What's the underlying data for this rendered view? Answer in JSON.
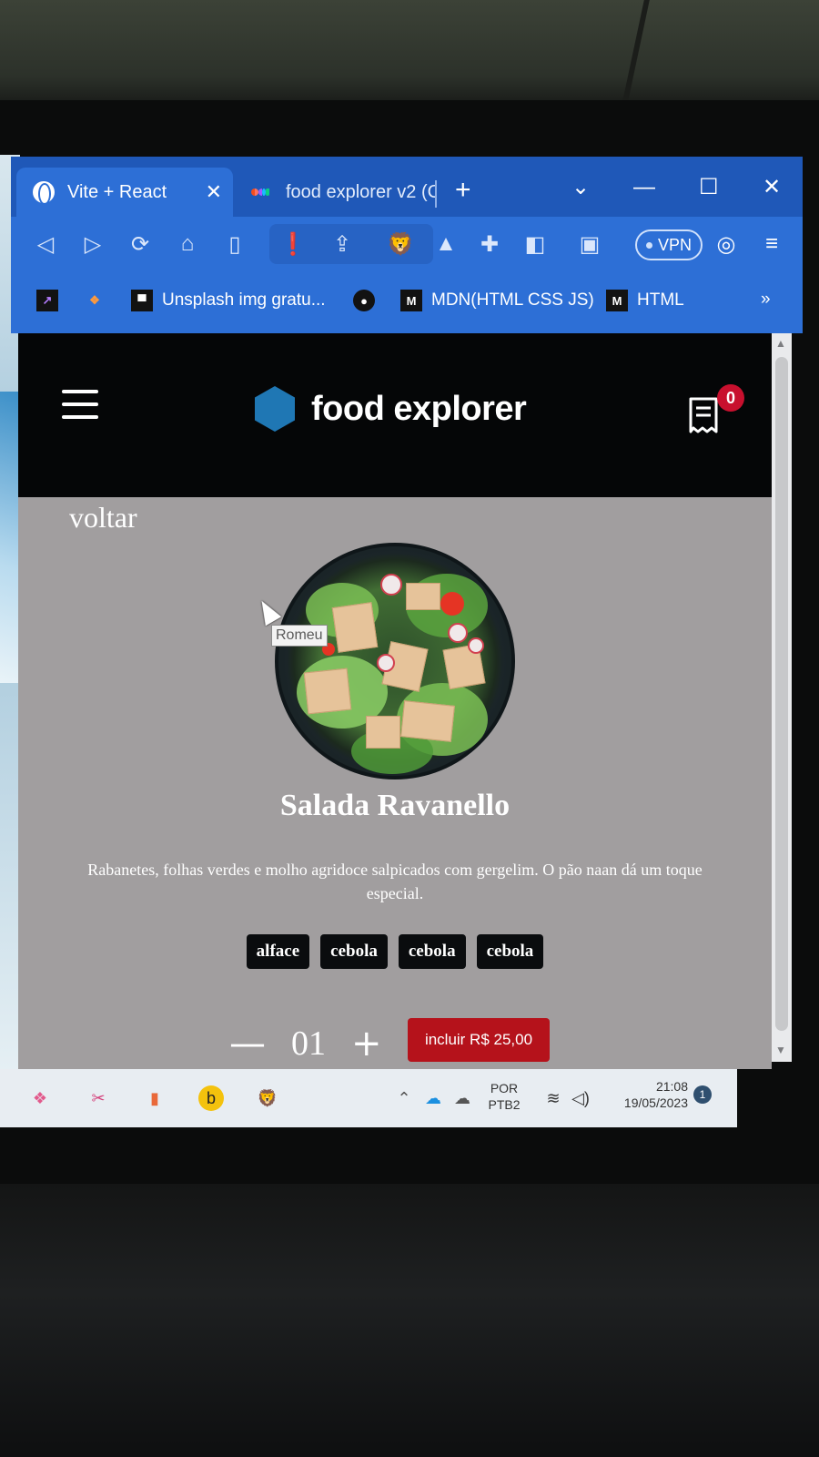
{
  "browser": {
    "tabs": [
      {
        "label": "Vite + React",
        "active": true
      },
      {
        "label": "food explorer v2 (C",
        "active": false
      }
    ],
    "close_glyph": "✕",
    "new_tab_glyph": "+",
    "window_controls": [
      "⌄",
      "—",
      "☐",
      "✕"
    ],
    "vpn_label": "VPN",
    "bookmarks": [
      {
        "label": "Unsplash img gratu..."
      },
      {
        "label": "MDN(HTML CSS JS)"
      },
      {
        "label": "HTML"
      }
    ],
    "bookmark_badge": "M",
    "more_glyph": "»"
  },
  "app": {
    "logo_text": "food explorer",
    "cart_count": "0",
    "back_label": "voltar",
    "tooltip": "Romeu",
    "dish": {
      "name": "Salada Ravanello",
      "description": "Rabanetes, folhas verdes e molho agridoce salpicados com gergelim. O pão naan dá um toque especial.",
      "ingredients": [
        "alface",
        "cebola",
        "cebola",
        "cebola"
      ],
      "quantity": "01",
      "include_label": "incluir R$ 25,00",
      "minus_glyph": "—",
      "plus_glyph": "+"
    }
  },
  "taskbar": {
    "lang_top": "POR",
    "lang_bottom": "PTB2",
    "time": "21:08",
    "date": "19/05/2023",
    "notifications": "1"
  },
  "colors": {
    "browser_blue": "#2d6fd6",
    "page_gray": "#a19e9f",
    "header_black": "#050607",
    "accent_red": "#b5121b",
    "logo_blue": "#1f77b4"
  }
}
